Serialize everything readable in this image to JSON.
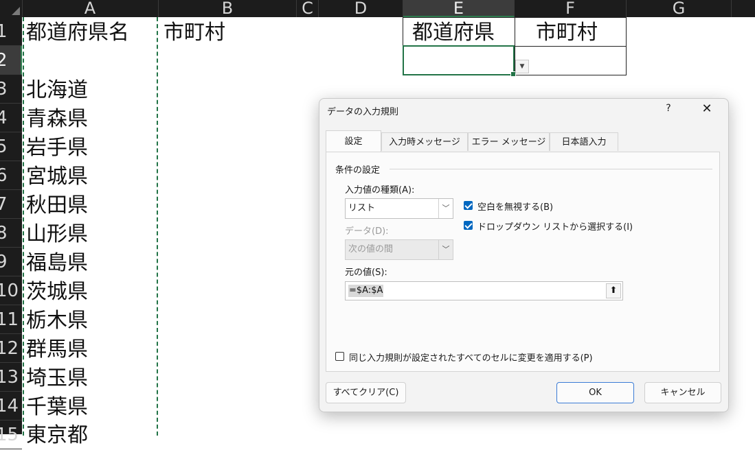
{
  "spreadsheet": {
    "columns": [
      "A",
      "B",
      "C",
      "D",
      "E",
      "F",
      "G"
    ],
    "selected_column": "E",
    "rows": [
      "1",
      "2",
      "3",
      "4",
      "5",
      "6",
      "7",
      "8",
      "9",
      "10",
      "11",
      "12",
      "13",
      "14",
      "15"
    ],
    "selected_row": "2",
    "column_a": [
      "都道府県名",
      "",
      "北海道",
      "青森県",
      "岩手県",
      "宮城県",
      "秋田県",
      "山形県",
      "福島県",
      "茨城県",
      "栃木県",
      "群馬県",
      "埼玉県",
      "千葉県",
      "東京都"
    ],
    "b1": "市町村",
    "e1": "都道府県",
    "f1": "市町村",
    "accent_color": "#217346"
  },
  "dialog": {
    "title": "データの入力規則",
    "help_label": "?",
    "close_label": "✕",
    "tabs": [
      "設定",
      "入力時メッセージ",
      "エラー メッセージ",
      "日本語入力"
    ],
    "active_tab": "設定",
    "group_label": "条件の設定",
    "allow_label": "入力値の種類(A):",
    "allow_value": "リスト",
    "ignore_blank_label": "空白を無視する(B)",
    "ignore_blank_checked": true,
    "dropdown_label": "ドロップダウン リストから選択する(I)",
    "dropdown_checked": true,
    "data_label": "データ(D):",
    "data_value": "次の値の間",
    "source_label": "元の値(S):",
    "source_value": "=$A:$A",
    "apply_all_label": "同じ入力規則が設定されたすべてのセルに変更を適用する(P)",
    "apply_all_checked": false,
    "clear_all_label": "すべてクリア(C)",
    "ok_label": "OK",
    "cancel_label": "キャンセル",
    "check_color": "#0067c0"
  }
}
